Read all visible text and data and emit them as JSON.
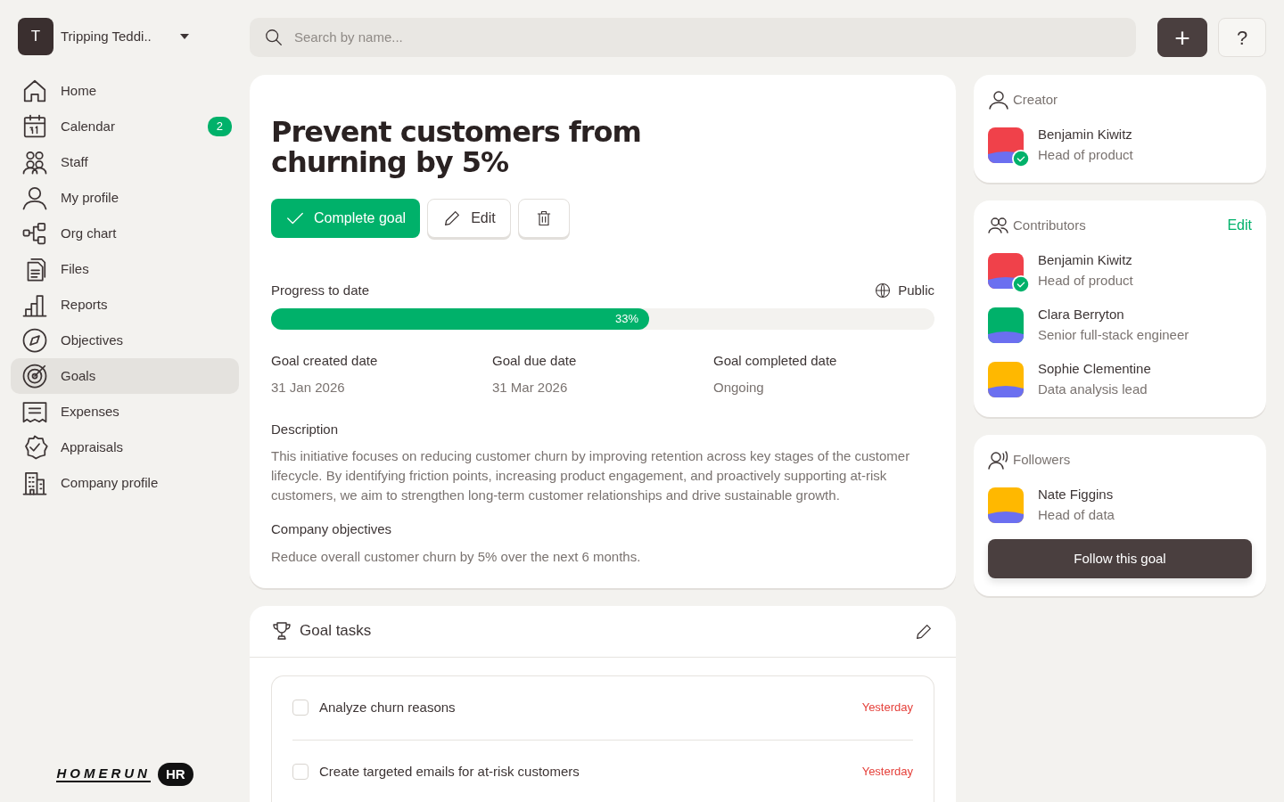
{
  "workspace": {
    "initial": "T",
    "name": "Tripping Teddi.."
  },
  "sidebar": {
    "items": [
      {
        "label": "Home",
        "selected": false
      },
      {
        "label": "Calendar",
        "selected": false,
        "badge": "2"
      },
      {
        "label": "Staff",
        "selected": false
      },
      {
        "label": "My profile",
        "selected": false
      },
      {
        "label": "Org chart",
        "selected": false
      },
      {
        "label": "Files",
        "selected": false
      },
      {
        "label": "Reports",
        "selected": false
      },
      {
        "label": "Objectives",
        "selected": false
      },
      {
        "label": "Goals",
        "selected": true
      },
      {
        "label": "Expenses",
        "selected": false
      },
      {
        "label": "Appraisals",
        "selected": false
      },
      {
        "label": "Company profile",
        "selected": false
      }
    ]
  },
  "logo": {
    "text": "HOMERUN",
    "badge": "HR"
  },
  "search": {
    "placeholder": "Search by name..."
  },
  "toolbar": {
    "add": "+",
    "help": "?"
  },
  "goal": {
    "title": "Prevent customers from churning by 5%",
    "actions": {
      "complete": "Complete goal",
      "edit": "Edit"
    },
    "progress": {
      "label": "Progress to date",
      "visibility": "Public",
      "level": 0.57,
      "reading": "33%"
    },
    "dates": [
      {
        "label": "Goal created date",
        "value": "31 Jan 2026"
      },
      {
        "label": "Goal due date",
        "value": "31 Mar 2026"
      },
      {
        "label": "Goal completed date",
        "value": "Ongoing"
      }
    ],
    "sections": [
      {
        "label": "Description",
        "text": "This initiative focuses on reducing customer churn by improving retention across key stages of the customer lifecycle. By identifying friction points, increasing product engagement, and proactively supporting at-risk customers, we aim to strengthen long-term customer relationships and drive sustainable growth."
      },
      {
        "label": "Company objectives",
        "text": "Reduce overall customer churn by 5% over the next 6 months."
      }
    ]
  },
  "tasks": {
    "title": "Goal tasks",
    "items": [
      {
        "label": "Analyze churn reasons",
        "checked": false,
        "due": "Yesterday"
      },
      {
        "label": "Create targeted emails for at-risk customers",
        "checked": false,
        "due": "Yesterday"
      }
    ]
  },
  "creator": {
    "title": "Creator",
    "people": [
      {
        "name": "Benjamin Kiwitz",
        "role": "Head of product",
        "verified": true,
        "color": "#f0414a"
      }
    ]
  },
  "contributors": {
    "title": "Contributors",
    "action": "Edit",
    "people": [
      {
        "name": "Benjamin Kiwitz",
        "role": "Head of product",
        "verified": true,
        "color": "#f0414a"
      },
      {
        "name": "Clara Berryton",
        "role": "Senior full-stack engineer",
        "verified": false,
        "color": "#00b16a"
      },
      {
        "name": "Sophie Clementine",
        "role": "Data analysis lead",
        "verified": false,
        "color": "#ffb800"
      }
    ]
  },
  "followers": {
    "title": "Followers",
    "button": "Follow this goal",
    "people": [
      {
        "name": "Nate Figgins",
        "role": "Head of data",
        "verified": false,
        "color": "#ffb800"
      }
    ]
  }
}
